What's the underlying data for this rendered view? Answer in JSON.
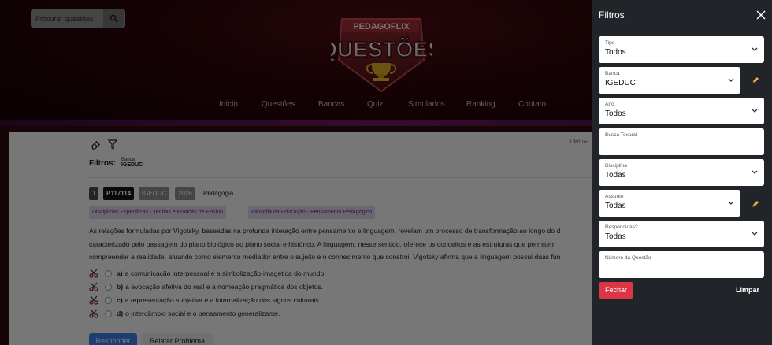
{
  "header": {
    "search_placeholder": "Procurar questões",
    "logo_top": "PEDAGOFLIX",
    "logo_main": "QUESTÕES",
    "nav": [
      "Início",
      "Questões",
      "Bancas",
      "Quiz",
      "Simulados",
      "Ranking",
      "Contato"
    ]
  },
  "main": {
    "results_count": "3.301 res",
    "filters_label": "Filtros:",
    "active_filter": {
      "label": "Banca",
      "value": "IGEDUC"
    },
    "question": {
      "number": "1",
      "id": "P117114",
      "banca": "IGEDUC",
      "year": "2026",
      "subject": "Pedagogia",
      "tags": [
        "Disciplinas Específicas - Teorias e Praticas de Ensino",
        "Filosofia da Educação - Pensamento Pedagógico"
      ],
      "text_lines": [
        "As relações formuladas por Vigotsky, baseadas na profunda interação entre pensamento e linguagem, revelam um processo de transformação ao longo do d",
        "caracterizado pelo passagem do plano biológico ao plano social e histórico. A linguagem, nesse sentido, oferece os conceitos e as estruturas que permitem",
        "compreender a realidade, atuando como elemento mediador entre o sujeito e o conhecimento que constrói. Vigotsky afirma que a linguagem possui duas fun"
      ],
      "options": [
        {
          "letter": "a)",
          "text": "a comunicação interpessoal e a simbolização imagética do mundo."
        },
        {
          "letter": "b)",
          "text": "a evocação afetiva do real e a nomeação pragmática dos objetos."
        },
        {
          "letter": "c)",
          "text": "a representação subjetiva e a internalização dos signos culturais."
        },
        {
          "letter": "d)",
          "text": "o intercâmbio social e o pensamento generalizante."
        }
      ]
    },
    "buttons": {
      "responder": "Responder",
      "relatar": "Relatar Problema"
    }
  },
  "panel": {
    "title": "Filtros",
    "fields": [
      {
        "label": "Tipo",
        "value": "Todos"
      },
      {
        "label": "Banca",
        "value": "IGEDUC"
      },
      {
        "label": "Ano",
        "value": "Todos"
      },
      {
        "label": "Busca Textual",
        "value": ""
      },
      {
        "label": "Disciplina",
        "value": "Todas"
      },
      {
        "label": "Assunto",
        "value": "Todas"
      },
      {
        "label": "Respondidas?",
        "value": "Todas"
      },
      {
        "label": "Número da Questão",
        "value": ""
      }
    ],
    "close_label": "Fechar",
    "clear_label": "Limpar"
  },
  "colors": {
    "accent_blue": "#3b7ddd",
    "danger": "#dc3545",
    "panel_bg": "#212529",
    "tag_bg": "#d9cde6",
    "tag_text": "#5a2d84"
  }
}
